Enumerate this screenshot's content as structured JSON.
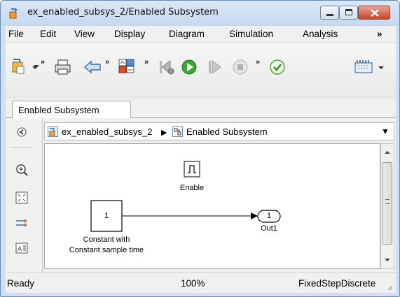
{
  "window": {
    "title": "ex_enabled_subsys_2/Enabled Subsystem"
  },
  "menu": {
    "items": [
      "File",
      "Edit",
      "View",
      "Display",
      "Diagram",
      "Simulation",
      "Analysis"
    ],
    "overflow": "»"
  },
  "toolbar": {
    "chevron": "»",
    "icons": [
      "model-browser-icon",
      "print-icon",
      "back-icon",
      "library-icon",
      "step-back-icon",
      "run-icon",
      "step-forward-icon",
      "stop-icon",
      "check-icon",
      "build-icon"
    ]
  },
  "tabs": [
    {
      "label": "Enabled Subsystem"
    }
  ],
  "address": {
    "root": "ex_enabled_subsys_2",
    "separator": "▶",
    "current": "Enabled Subsystem",
    "dropdown": "▼"
  },
  "blocks": {
    "enable_label": "Enable",
    "constant_value": "1",
    "constant_label_line1": "Constant with",
    "constant_label_line2": "Constant sample time",
    "out_value": "1",
    "out_label": "Out1"
  },
  "status": {
    "state": "Ready",
    "zoom": "100%",
    "solver": "FixedStepDiscrete"
  }
}
